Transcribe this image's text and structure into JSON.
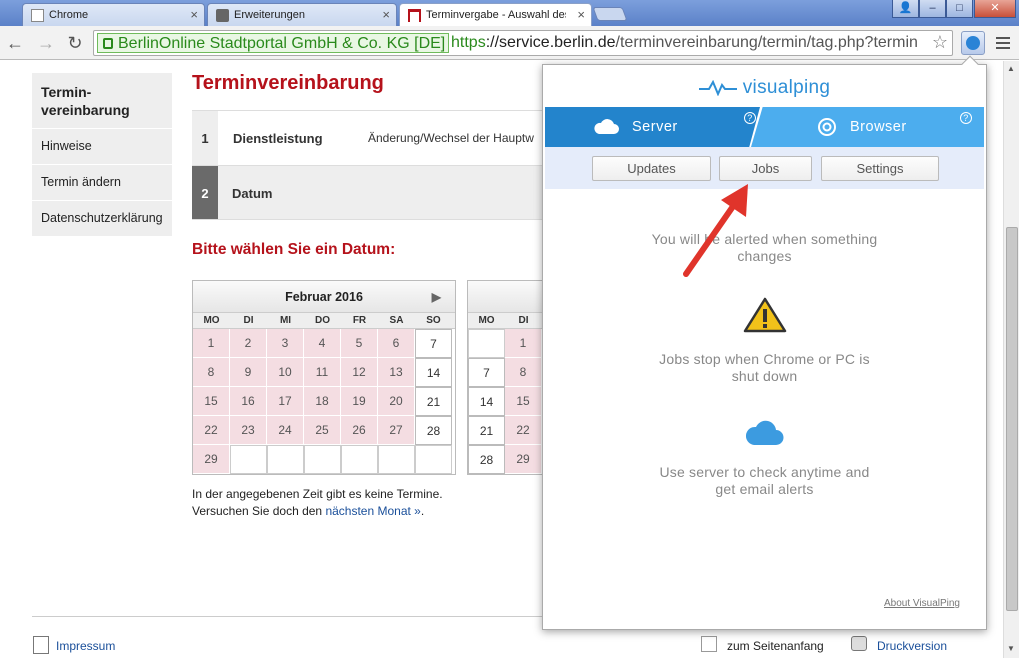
{
  "browser": {
    "tabs": [
      {
        "label": "Chrome",
        "close": "×"
      },
      {
        "label": "Erweiterungen",
        "close": "×"
      },
      {
        "label": "Terminvergabe - Auswahl des",
        "close": "×"
      }
    ],
    "ev_label": "BerlinOnline Stadtportal GmbH & Co. KG [DE]",
    "url_scheme": "https",
    "url_host": "://service.berlin.de",
    "url_path": "/terminvereinbarung/termin/tag.php?termin",
    "window_controls": {
      "user": "👤",
      "minimize": "–",
      "maximize": "□",
      "close": "✕"
    },
    "nav": {
      "back": "←",
      "forward": "→",
      "reload": "↻"
    }
  },
  "sidebar": {
    "items": [
      "Termin-\nvereinbarung",
      "Hinweise",
      "Termin ändern",
      "Datenschutzerklärung"
    ]
  },
  "main": {
    "title": "Terminvereinbarung",
    "steps": [
      {
        "num": "1",
        "label": "Dienstleistung",
        "value": "Änderung/Wechsel der Hauptw"
      },
      {
        "num": "2",
        "label": "Datum",
        "value": ""
      }
    ],
    "date_heading": "Bitte wählen Sie ein Datum:",
    "weekdays": [
      "MO",
      "DI",
      "MI",
      "DO",
      "FR",
      "SA",
      "SO"
    ],
    "calendar_feb": {
      "month": "Februar 2016",
      "next": "▶",
      "days": [
        "1",
        "2",
        "3",
        "4",
        "5",
        "6",
        "7",
        "8",
        "9",
        "10",
        "11",
        "12",
        "13",
        "14",
        "15",
        "16",
        "17",
        "18",
        "19",
        "20",
        "21",
        "22",
        "23",
        "24",
        "25",
        "26",
        "27",
        "28",
        "29",
        "",
        "",
        "",
        "",
        "",
        ""
      ],
      "free_days": [
        "7",
        "14",
        "21",
        "28"
      ]
    },
    "calendar_mar_partial": {
      "cells": [
        "",
        "1",
        "7",
        "8",
        "14",
        "15",
        "21",
        "22",
        "28",
        "29"
      ]
    },
    "no_dates_line1": "In der angegebenen Zeit gibt es keine Termine.",
    "no_dates_line2_prefix": "Versuchen Sie doch den",
    "no_dates_link": "nächsten Monat »",
    "no_dates_suffix": "."
  },
  "footer": {
    "impressum": "Impressum",
    "top": "zum Seitenanfang",
    "print": "Druckversion"
  },
  "popup": {
    "logo": "visualping",
    "mode_tabs": [
      {
        "label": "Server",
        "help": "?"
      },
      {
        "label": "Browser",
        "help": "?"
      }
    ],
    "subtabs": [
      "Updates",
      "Jobs",
      "Settings"
    ],
    "info1": "You will be alerted when something changes",
    "info2": "Jobs stop when Chrome or PC is shut down",
    "info3": "Use server to check anytime and get email alerts",
    "about": "About VisualPing"
  },
  "colors": {
    "accent_red": "#b5121b",
    "server_tab": "#2384cc",
    "browser_tab": "#4cadee",
    "unavailable_day": "#f4dde2",
    "annotation_arrow": "#e0342b"
  }
}
